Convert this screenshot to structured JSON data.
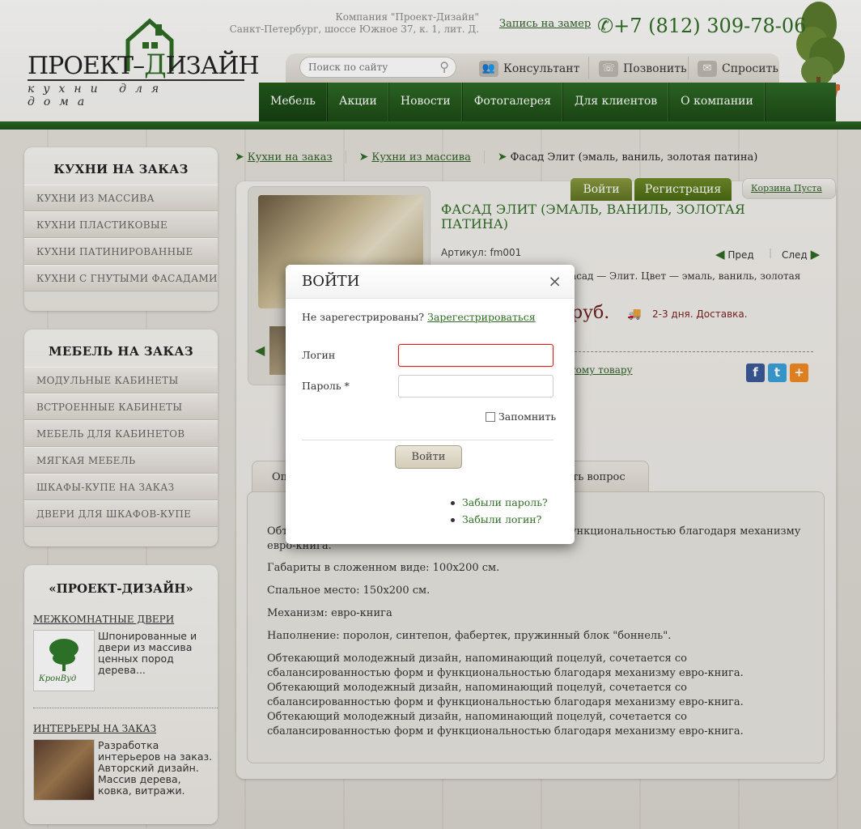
{
  "header": {
    "logo_main_part1": "ПРОЕКТ–",
    "logo_main_part2": "ИЗАЙН",
    "logo_tagline": "кухни для дома",
    "company_name": "Компания \"Проект-Дизайн\"",
    "company_address": "Санкт-Петербург, шоссе Южное 37, к. 1, лит. Д.",
    "measure_link": "Запись на замер",
    "phone": "+7 (812) 309-78-06",
    "search_placeholder": "Поиск по сайту",
    "consultant": "Консультант",
    "call": "Позвонить",
    "ask": "Спросить",
    "icons": [
      "phone-icon",
      "search-icon",
      "consultant-icon",
      "call-icon",
      "mail-icon"
    ]
  },
  "nav": {
    "items": [
      "Мебель",
      "Акции",
      "Новости",
      "Фотогалерея",
      "Для клиентов",
      "О компании"
    ],
    "active": "Мебель"
  },
  "sidebar": {
    "kitchens": {
      "title": "КУХНИ НА ЗАКАЗ",
      "items": [
        "КУХНИ ИЗ МАССИВА",
        "КУХНИ ПЛАСТИКОВЫЕ",
        "КУХНИ ПАТИНИРОВАННЫЕ",
        "КУХНИ С ГНУТЫМИ ФАСАДАМИ"
      ]
    },
    "furniture": {
      "title": "МЕБЕЛЬ НА ЗАКАЗ",
      "items": [
        "МОДУЛЬНЫЕ КАБИНЕТЫ",
        "ВСТРОЕННЫЕ КАБИНЕТЫ",
        "МЕБЕЛЬ ДЛЯ КАБИНЕТОВ",
        "МЯГКАЯ МЕБЕЛЬ",
        "ШКАФЫ-КУПЕ НА ЗАКАЗ",
        "ДВЕРИ ДЛЯ ШКАФОВ-КУПЕ"
      ]
    },
    "promo": {
      "title": "«ПРОЕКТ-ДИЗАЙН»",
      "doors_link": "МЕЖКОМНАТНЫЕ ДВЕРИ",
      "doors_text": "Шпонированные и двери из массива ценных пород дерева...",
      "doors_logo_text": "КронВуд",
      "interiors_link": "ИНТЕРЬЕРЫ НА ЗАКАЗ",
      "interiors_text": "Разработка интерьеров на заказ. Авторский дизайн. Массив дерева, ковка, витражи."
    }
  },
  "breadcrumbs": {
    "items": [
      "Кухни на заказ",
      "Кухни из массива"
    ],
    "current": "Фасад Элит (эмаль, ваниль, золотая патина)"
  },
  "account": {
    "login": "Войти",
    "register": "Регистрация",
    "cart": "Корзина Пуста"
  },
  "product": {
    "title": "ФАСАД ЭЛИТ (ЭМАЛЬ, ВАНИЛЬ, ЗОЛОТАЯ ПАТИНА)",
    "article": "Артикул: fm001",
    "prev": "Пред",
    "next": "След",
    "short_desc": "асад — Элит. Цвет — эмаль, ваниль, золотая",
    "price_unit": "руб.",
    "delivery": "2-3 дня. Доставка.",
    "to_product_link": "тому товару",
    "social": [
      "f",
      "t",
      "+"
    ],
    "tabs": [
      "Оп",
      "ть вопрос"
    ],
    "paragraphs": [
      "Обт                                                                      уй, сочетается со сбалансированностью форм и функциональностью благодаря механизму евро-книга.",
      "Габариты в сложенном виде: 100х200 см.",
      "Спальное место: 150х200 см.",
      "Механизм: евро-книга",
      "Наполнение: поролон, синтепон, фабертек, пружинный блок \"боннель\".",
      "Обтекающий молодежный дизайн, напоминающий поцелуй, сочетается со сбалансированностью форм и функциональностью благодаря механизму евро-книга. Обтекающий молодежный дизайн, напоминающий поцелуй, сочетается со сбалансированностью форм и функциональностью благодаря механизму евро-книга. Обтекающий молодежный дизайн, напоминающий поцелуй, сочетается со сбалансированностью форм и функциональностью благодаря механизму евро-книга."
    ]
  },
  "login_modal": {
    "title": "ВОЙТИ",
    "close": "×",
    "not_registered": "Не зарегестрированы?",
    "register_link": "Зарегестрироваться",
    "login_label": "Логин",
    "login_value": "",
    "password_label": "Пароль *",
    "password_value": "",
    "remember": "Запомнить",
    "remember_checked": false,
    "submit": "Войти",
    "forgot_password": "Забыли пароль?",
    "forgot_login": "Забыли логин?"
  },
  "colors": {
    "brand_green": "#2f6b25",
    "price_red": "#6a1f1f",
    "focus_border": "#d02020"
  }
}
